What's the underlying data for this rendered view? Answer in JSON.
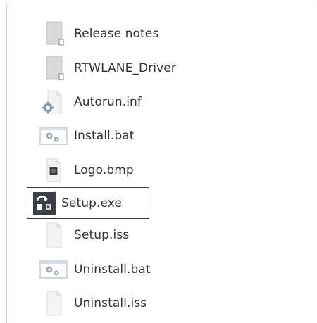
{
  "files": [
    {
      "name": "Release notes",
      "icon": "folder-doc-icon"
    },
    {
      "name": "RTWLANE_Driver",
      "icon": "folder-doc-icon"
    },
    {
      "name": "Autorun.inf",
      "icon": "settings-file-icon"
    },
    {
      "name": "Install.bat",
      "icon": "batch-file-icon"
    },
    {
      "name": "Logo.bmp",
      "icon": "image-file-icon"
    },
    {
      "name": "Setup.exe",
      "icon": "setup-exe-icon"
    },
    {
      "name": "Setup.iss",
      "icon": "blank-file-icon"
    },
    {
      "name": "Uninstall.bat",
      "icon": "batch-file-icon"
    },
    {
      "name": "Uninstall.iss",
      "icon": "blank-file-icon"
    }
  ],
  "selected_file": "Setup.exe"
}
